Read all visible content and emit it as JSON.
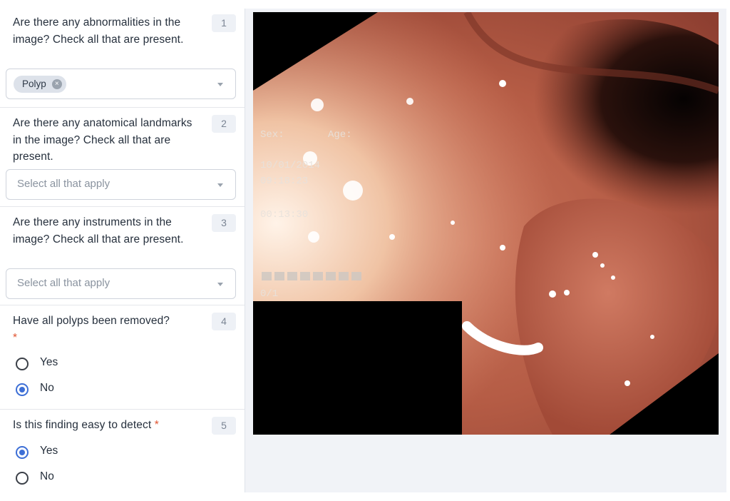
{
  "form": {
    "questions": [
      {
        "number": "1",
        "text": "Are there any abnormalities in the image? Check all that are present.",
        "selected_chip": "Polyp",
        "chip_remove_icon": "close-icon",
        "placeholder": ""
      },
      {
        "number": "2",
        "text": "Are there any anatomical landmarks in the image? Check all that are present.",
        "placeholder": "Select all that apply"
      },
      {
        "number": "3",
        "text": "Are there any instruments in the image? Check all that are present.",
        "placeholder": "Select all that apply"
      },
      {
        "number": "4",
        "text": "Have all polyps been removed?",
        "required_mark": "*",
        "options": [
          {
            "label": "Yes",
            "selected": false
          },
          {
            "label": "No",
            "selected": true
          }
        ]
      },
      {
        "number": "5",
        "text": "Is this finding easy to detect",
        "required_mark": "*",
        "options": [
          {
            "label": "Yes",
            "selected": true
          },
          {
            "label": "No",
            "selected": false
          }
        ]
      }
    ],
    "dropdown_icon": "chevron-down-icon",
    "accent_color": "#3d6fd6",
    "required_color": "#e0532f"
  },
  "viewer": {
    "image_overlay": {
      "sex_label": "Sex:",
      "age_label": "Age:",
      "date": "10/01/2014",
      "time": "09:18:23",
      "elapsed": "00:13:30",
      "counter": "0/1"
    }
  }
}
